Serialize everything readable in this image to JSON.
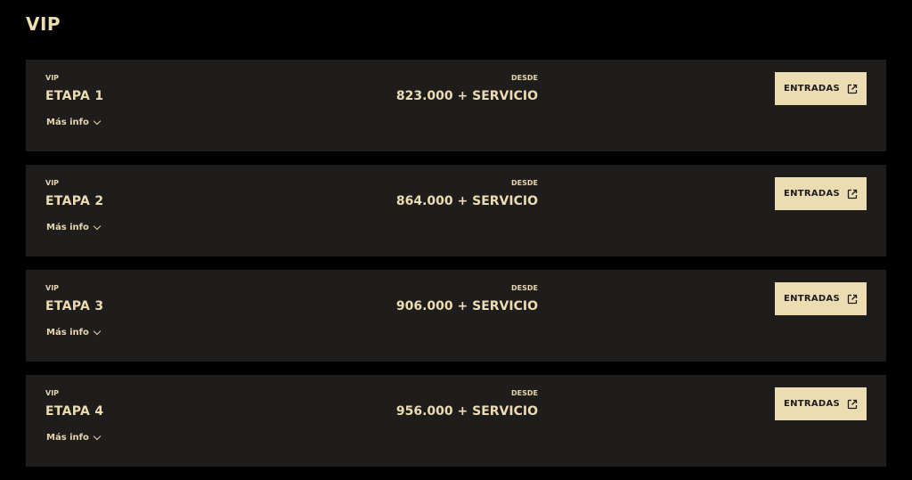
{
  "section": {
    "title": "VIP"
  },
  "cards": [
    {
      "category": "VIP",
      "stage": "ETAPA 1",
      "from_label": "DESDE",
      "price": "823.000 + SERVICIO",
      "more_info": "Más info",
      "button": "ENTRADAS"
    },
    {
      "category": "VIP",
      "stage": "ETAPA 2",
      "from_label": "DESDE",
      "price": "864.000 + SERVICIO",
      "more_info": "Más info",
      "button": "ENTRADAS"
    },
    {
      "category": "VIP",
      "stage": "ETAPA 3",
      "from_label": "DESDE",
      "price": "906.000 + SERVICIO",
      "more_info": "Más info",
      "button": "ENTRADAS"
    },
    {
      "category": "VIP",
      "stage": "ETAPA 4",
      "from_label": "DESDE",
      "price": "956.000 + SERVICIO",
      "more_info": "Más info",
      "button": "ENTRADAS"
    }
  ],
  "icons": {
    "more_info": "chevron-down-icon",
    "button": "external-link-icon"
  },
  "colors": {
    "background": "#000000",
    "card": "#1f1c1c",
    "accent": "#ecdcb2"
  }
}
